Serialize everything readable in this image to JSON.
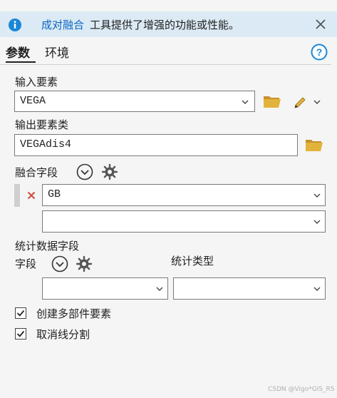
{
  "banner": {
    "tool_name": "成对融合",
    "message": "工具提供了增强的功能或性能。"
  },
  "tabs": [
    {
      "label": "参数",
      "active": true
    },
    {
      "label": "环境",
      "active": false
    }
  ],
  "input_features": {
    "label": "输入要素",
    "value": "VEGA"
  },
  "output_feature_class": {
    "label": "输出要素类",
    "value": "VEGAdis4"
  },
  "dissolve_fields": {
    "label": "融合字段",
    "rows": [
      {
        "value": "GB"
      },
      {
        "value": ""
      }
    ]
  },
  "statistics_fields": {
    "label": "统计数据字段",
    "field_label": "字段",
    "type_label": "统计类型",
    "field_value": "",
    "type_value": ""
  },
  "options": [
    {
      "label": "创建多部件要素",
      "checked": true
    },
    {
      "label": "取消线分割",
      "checked": true
    }
  ],
  "watermark": "CSDN @Vigo*GIS_RS",
  "colors": {
    "banner_bg": "#dbeaf4",
    "link": "#0a66c2",
    "folder": "#d9a72e",
    "help": "#1a86d8",
    "remove_x": "#d04a3a"
  }
}
